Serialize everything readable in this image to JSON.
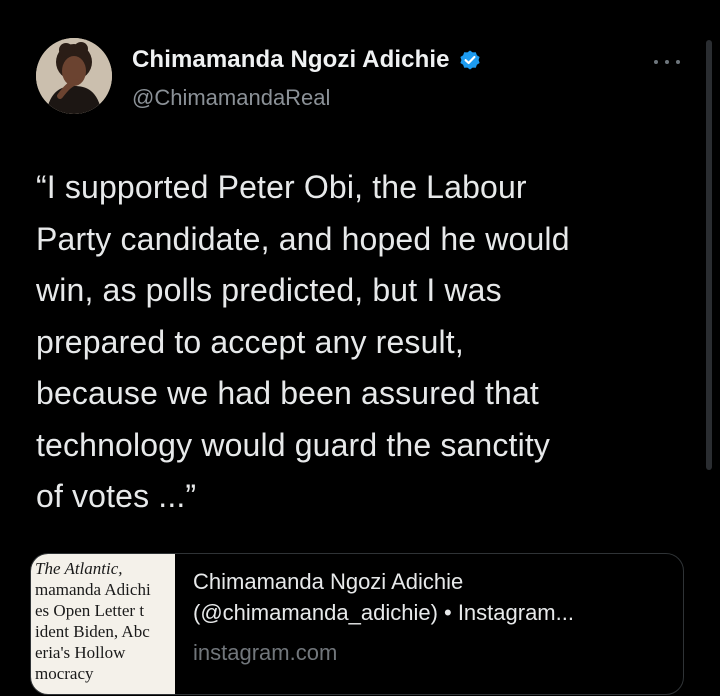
{
  "author": {
    "display_name": "Chimamanda Ngozi Adichie",
    "handle": "@ChimamandaReal",
    "verified": true,
    "verified_color": "#1d9bf0"
  },
  "more_icon": "more-horizontal-icon",
  "tweet": {
    "text": "“I supported Peter Obi, the Labour\nParty candidate, and hoped he would\nwin, as polls predicted, but I was\nprepared to accept any result,\nbecause we had been assured that\ntechnology would guard the sanctity\nof votes ...”"
  },
  "link_card": {
    "thumbnail": {
      "publication": "The Atlantic,",
      "text": "mamanda Adichi\nes Open Letter t\nident Biden, Abc\neria's Hollow\nmocracy"
    },
    "title": "Chimamanda Ngozi Adichie\n(@chimamanda_adichie) • Instagram...",
    "domain": "instagram.com"
  },
  "colors": {
    "background": "#000000",
    "text_primary": "#e7e9ea",
    "text_secondary": "#71767b",
    "border": "#2f3336"
  }
}
